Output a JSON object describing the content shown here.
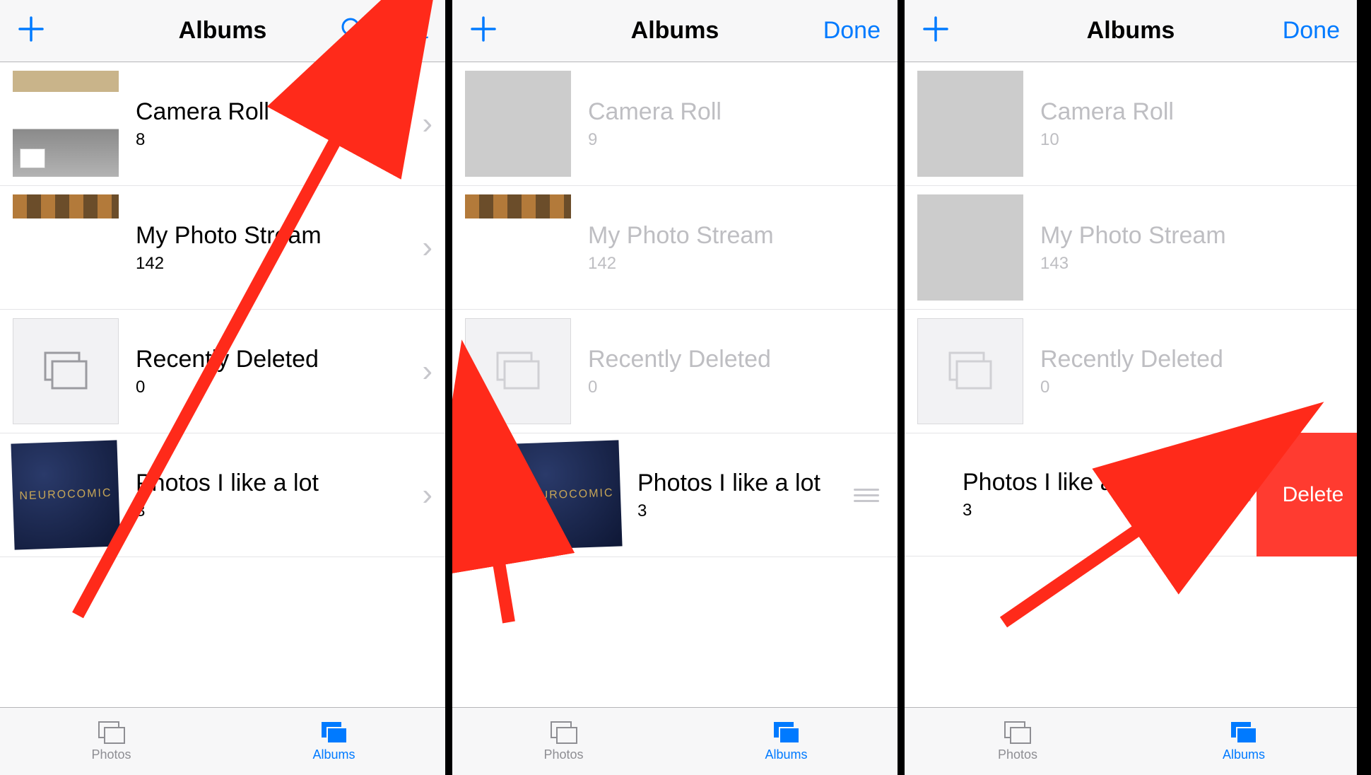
{
  "colors": {
    "tint": "#007aff",
    "destructive": "#ff3b30"
  },
  "tabbar": {
    "photos": "Photos",
    "albums": "Albums"
  },
  "screens": [
    {
      "navTitle": "Albums",
      "rightAction": "Edit",
      "showSearch": true,
      "showDelete": false,
      "albums": [
        {
          "name": "Camera Roll",
          "count": "8",
          "showChevron": true,
          "dimmed": false,
          "thumb": "cameraroll"
        },
        {
          "name": "My Photo Stream",
          "count": "142",
          "showChevron": true,
          "dimmed": false,
          "thumb": "stream"
        },
        {
          "name": "Recently Deleted",
          "count": "0",
          "showChevron": true,
          "dimmed": false,
          "thumb": "recent"
        },
        {
          "name": "Photos I like a lot",
          "count": "3",
          "showChevron": true,
          "dimmed": false,
          "thumb": "book"
        }
      ]
    },
    {
      "navTitle": "Albums",
      "rightAction": "Done",
      "showSearch": false,
      "showDelete": false,
      "albums": [
        {
          "name": "Camera Roll",
          "count": "9",
          "dimmed": true,
          "thumb": "collage"
        },
        {
          "name": "My Photo Stream",
          "count": "142",
          "dimmed": true,
          "thumb": "stream"
        },
        {
          "name": "Recently Deleted",
          "count": "0",
          "dimmed": true,
          "thumb": "recent"
        },
        {
          "name": "Photos I like a lot",
          "count": "3",
          "dimmed": false,
          "editable": true,
          "thumb": "book"
        }
      ]
    },
    {
      "navTitle": "Albums",
      "rightAction": "Done",
      "showSearch": false,
      "showDelete": true,
      "deleteLabel": "Delete",
      "albums": [
        {
          "name": "Camera Roll",
          "count": "10",
          "dimmed": true,
          "thumb": "collage"
        },
        {
          "name": "My Photo Stream",
          "count": "143",
          "dimmed": true,
          "thumb": "collage"
        },
        {
          "name": "Recently Deleted",
          "count": "0",
          "dimmed": true,
          "thumb": "recent"
        },
        {
          "name": "Photos I like a lot",
          "count": "3",
          "dimmed": false,
          "showDeleteButton": true,
          "thumb": "hidden"
        }
      ]
    }
  ]
}
